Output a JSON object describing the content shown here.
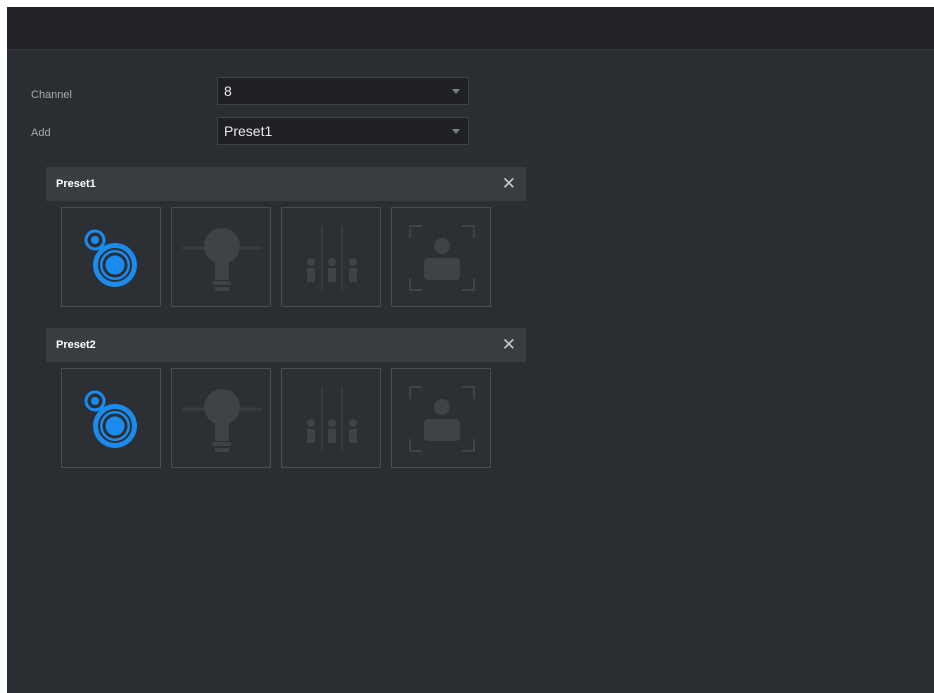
{
  "form": {
    "channel_label": "Channel",
    "channel_value": "8",
    "add_label": "Add",
    "add_value": "Preset1"
  },
  "presets": [
    {
      "title": "Preset1",
      "close_glyph": "✕"
    },
    {
      "title": "Preset2",
      "close_glyph": "✕"
    }
  ],
  "tile_icons": [
    "ptz-target-icon",
    "lightbulb-icon",
    "people-counting-icon",
    "face-recognition-icon"
  ],
  "colors": {
    "accent": "#1a8cf0",
    "icon_dim": "#3f4246",
    "background": "#2a2d31"
  }
}
